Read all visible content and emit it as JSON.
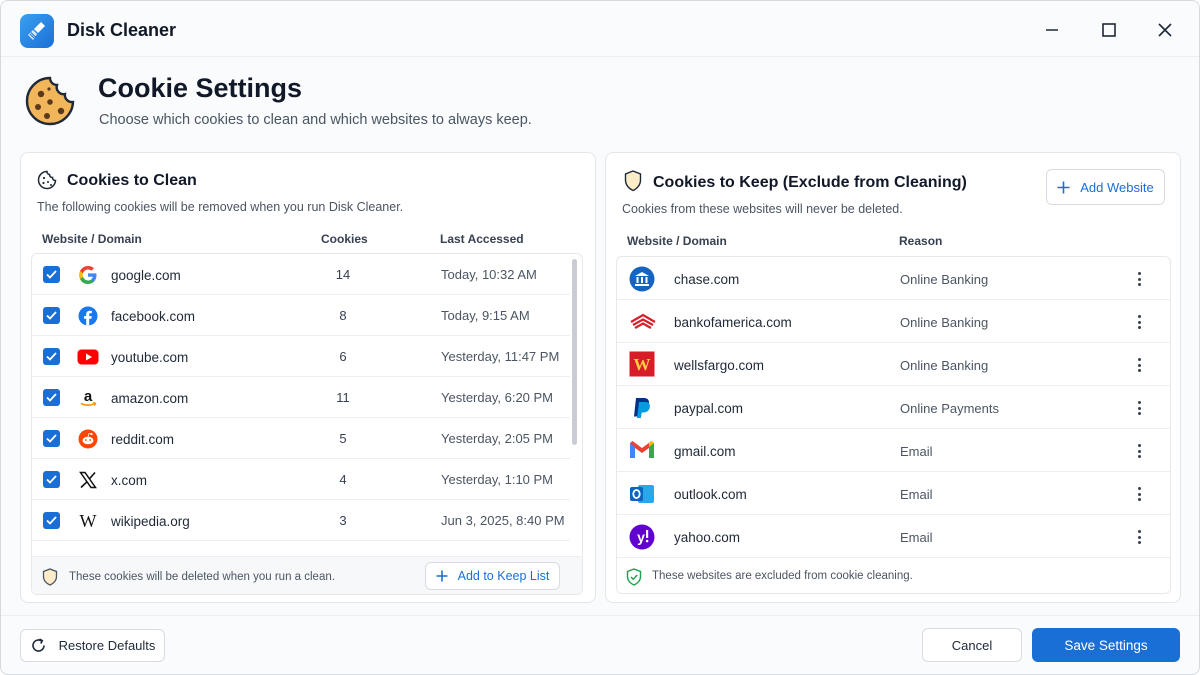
{
  "app": {
    "title": "Disk Cleaner"
  },
  "header": {
    "title": "Cookie Settings",
    "subtitle": "Choose which cookies to clean and which websites to always keep."
  },
  "clean": {
    "title": "Cookies to Clean",
    "description": "The following cookies will be removed when you run Disk Cleaner.",
    "col_domain": "Website / Domain",
    "col_cookies": "Cookies",
    "col_accessed": "Last Accessed",
    "rows": [
      {
        "domain": "google.com",
        "cookies": "14",
        "accessed": "Today, 10:32 AM",
        "icon": "google-icon"
      },
      {
        "domain": "facebook.com",
        "cookies": "8",
        "accessed": "Today, 9:15 AM",
        "icon": "facebook-icon"
      },
      {
        "domain": "youtube.com",
        "cookies": "6",
        "accessed": "Yesterday, 11:47 PM",
        "icon": "youtube-icon"
      },
      {
        "domain": "amazon.com",
        "cookies": "11",
        "accessed": "Yesterday, 6:20 PM",
        "icon": "amazon-icon"
      },
      {
        "domain": "reddit.com",
        "cookies": "5",
        "accessed": "Yesterday, 2:05 PM",
        "icon": "reddit-icon"
      },
      {
        "domain": "x.com",
        "cookies": "4",
        "accessed": "Yesterday, 1:10 PM",
        "icon": "x-icon"
      },
      {
        "domain": "wikipedia.org",
        "cookies": "3",
        "accessed": "Jun 3, 2025, 8:40 PM",
        "icon": "wikipedia-icon"
      }
    ],
    "footer_note": "These cookies will be deleted when you run a clean.",
    "add_keep_label": "Add to Keep List"
  },
  "keep": {
    "title": "Cookies to Keep (Exclude from Cleaning)",
    "description": "Cookies from these websites will never be deleted.",
    "add_website_label": "Add Website",
    "col_domain": "Website / Domain",
    "col_reason": "Reason",
    "rows": [
      {
        "domain": "chase.com",
        "reason": "Online Banking",
        "icon": "chase-icon"
      },
      {
        "domain": "bankofamerica.com",
        "reason": "Online Banking",
        "icon": "bankofamerica-icon"
      },
      {
        "domain": "wellsfargo.com",
        "reason": "Online Banking",
        "icon": "wellsfargo-icon"
      },
      {
        "domain": "paypal.com",
        "reason": "Online Payments",
        "icon": "paypal-icon"
      },
      {
        "domain": "gmail.com",
        "reason": "Email",
        "icon": "gmail-icon"
      },
      {
        "domain": "outlook.com",
        "reason": "Email",
        "icon": "outlook-icon"
      },
      {
        "domain": "yahoo.com",
        "reason": "Email",
        "icon": "yahoo-icon"
      }
    ],
    "footer_note": "These websites are excluded from cookie cleaning."
  },
  "footer": {
    "restore_label": "Restore Defaults",
    "cancel_label": "Cancel",
    "save_label": "Save Settings"
  },
  "colors": {
    "accent": "#1a6fd6"
  }
}
